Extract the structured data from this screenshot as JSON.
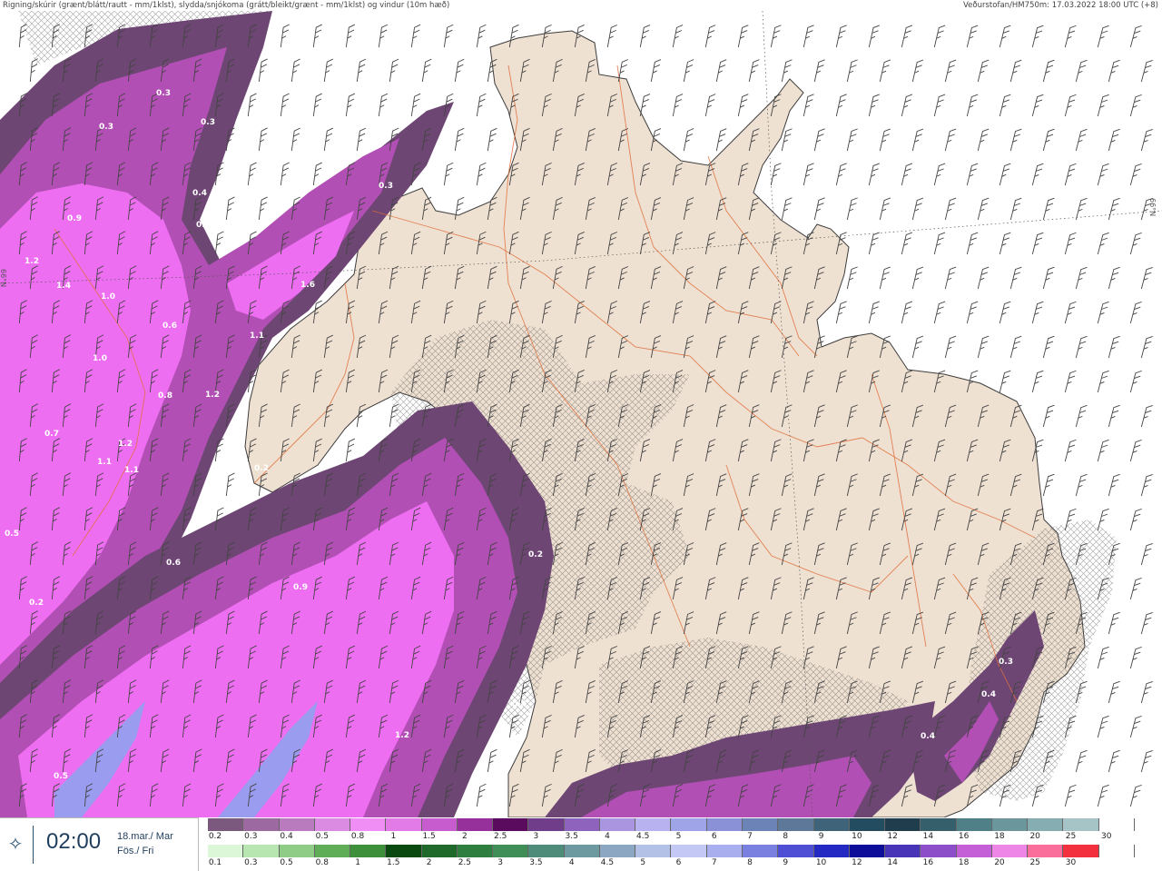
{
  "header": {
    "title": "Rigning/skúrir (grænt/blátt/rautt - mm/1klst), slydda/snjókoma (grátt/bleikt/grænt - mm/1klst) og vindur (10m hæð)",
    "source": "Veðurstofan/HM750m: 17.03.2022 18:00 UTC (+8)"
  },
  "map": {
    "latitude_labels": [
      "66°N",
      "66°N"
    ],
    "value_labels": [
      "0.3",
      "0.3",
      "0.3",
      "0.4",
      "0.4",
      "0.3",
      "0.9",
      "1.2",
      "1.4",
      "1.0",
      "1.6",
      "0.6",
      "1.1",
      "1.0",
      "0.8",
      "1.2",
      "0.7",
      "1.2",
      "1.1",
      "1.1",
      "0.2",
      "0.5",
      "0.6",
      "0.2",
      "0.9",
      "0.2",
      "0.4",
      "1.2",
      "0.5",
      "0.3",
      "0.4",
      "0.4"
    ],
    "colors": {
      "land": "#efe1d2",
      "sea": "#ffffff",
      "coast": "#3d3d3d",
      "roads": "#e0703c",
      "snow_light": "#6d4673",
      "snow_mid": "#b24fb4",
      "snow_heavy": "#ee6ef2",
      "rain_blue": "#9a9cf0"
    }
  },
  "time_panel": {
    "icon": "play-icon",
    "time": "02:00",
    "date_line1": "18.mar./ Mar",
    "date_line2": "Fös./ Fri"
  },
  "legend": {
    "snow_labels": [
      "0.2",
      "0.3",
      "0.4",
      "0.5",
      "0.8",
      "1",
      "1.5",
      "2",
      "2.5",
      "3",
      "3.5",
      "4",
      "4.5",
      "5",
      "6",
      "7",
      "8",
      "9",
      "10",
      "12",
      "14",
      "16",
      "18",
      "20",
      "25",
      "30"
    ],
    "snow_colors": [
      "#7b587e",
      "#9c6aa0",
      "#b97bbe",
      "#dc8be2",
      "#f18ef6",
      "#e27be8",
      "#c65ccd",
      "#96319b",
      "#5a0b5e",
      "#6f3d8a",
      "#8d63bd",
      "#a995e0",
      "#b9b2f0",
      "#9fa3e8",
      "#8a91d6",
      "#6c83b8",
      "#5d7898",
      "#3f647a",
      "#244c60",
      "#203d4e",
      "#355f6b",
      "#4f7f87",
      "#6a969c",
      "#86aeb2",
      "#a6c4c6",
      "#ffffff"
    ],
    "rain_labels": [
      "0.1",
      "0.3",
      "0.5",
      "0.8",
      "1",
      "1.5",
      "2",
      "2.5",
      "3",
      "3.5",
      "4",
      "4.5",
      "5",
      "6",
      "7",
      "8",
      "9",
      "10",
      "12",
      "14",
      "16",
      "18",
      "20",
      "25",
      "30"
    ],
    "rain_colors": [
      "#dcf7d8",
      "#b7e6b0",
      "#8fcd86",
      "#5fae57",
      "#3d8f39",
      "#0a4a10",
      "#1f6a2a",
      "#2e7e40",
      "#3f8e58",
      "#4e8c79",
      "#6d9aa0",
      "#8ca7c1",
      "#b3c1e6",
      "#c3c8f4",
      "#a9aeee",
      "#7a80e0",
      "#4e4fd4",
      "#2329c2",
      "#0d0d9a",
      "#4734b6",
      "#8d4ec9",
      "#c55fd8",
      "#ee86e8",
      "#f96e9a",
      "#f2303e",
      "#ffffff"
    ]
  }
}
